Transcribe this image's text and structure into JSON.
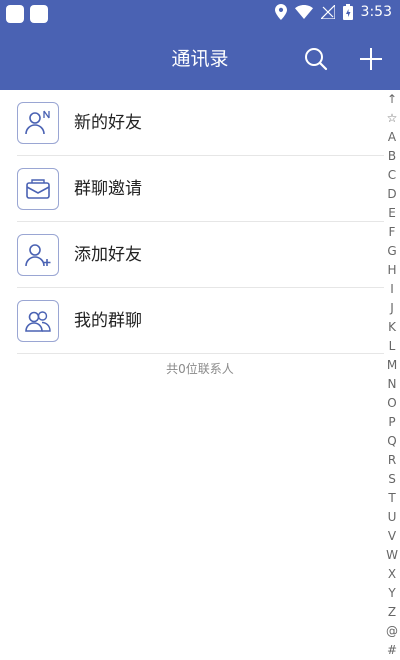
{
  "status_bar": {
    "time": "3:53"
  },
  "header": {
    "title": "通讯录"
  },
  "menu": [
    {
      "label": "新的好友",
      "icon": "new-friend-icon"
    },
    {
      "label": "群聊邀请",
      "icon": "group-invite-icon"
    },
    {
      "label": "添加好友",
      "icon": "add-friend-icon"
    },
    {
      "label": "我的群聊",
      "icon": "my-groups-icon"
    }
  ],
  "contact_count": "共0位联系人",
  "index_letters": [
    "↑",
    "☆",
    "A",
    "B",
    "C",
    "D",
    "E",
    "F",
    "G",
    "H",
    "I",
    "J",
    "K",
    "L",
    "M",
    "N",
    "O",
    "P",
    "Q",
    "R",
    "S",
    "T",
    "U",
    "V",
    "W",
    "X",
    "Y",
    "Z",
    "@",
    "#"
  ],
  "colors": {
    "header_bg": "#4a62b3",
    "icon_stroke": "#4a62b3"
  }
}
